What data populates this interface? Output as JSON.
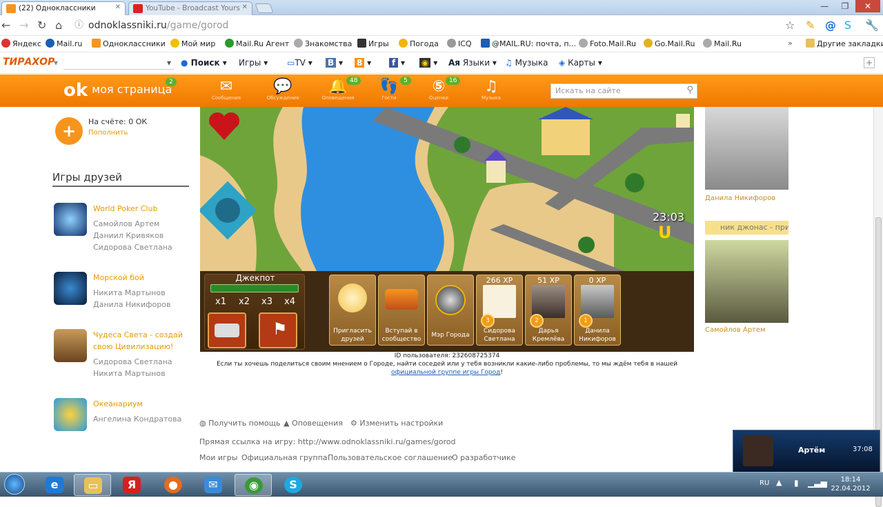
{
  "tabs": [
    {
      "title": "(22) Одноклассники"
    },
    {
      "title": "YouTube - Broadcast Yours"
    }
  ],
  "url": {
    "host": "odnoklassniki.ru",
    "path": "/game/gorod"
  },
  "bookmarks": [
    "Яндекс",
    "Mail.ru",
    "Одноклассники",
    "Мой мир",
    "Mail.Ru Агент",
    "Знакомства",
    "Игры",
    "Погода",
    "ICQ",
    "@MAIL.RU: почта, п...",
    "Foto.Mail.Ru",
    "Go.Mail.Ru",
    "Mail.Ru"
  ],
  "other_bookmarks": "Другие закладки",
  "toolbar2": {
    "brand": "ТИРАХОР",
    "search": "Поиск",
    "games": "Игры",
    "tv": "TV",
    "langs": "Языки",
    "music": "Музыка",
    "maps": "Карты"
  },
  "ok": {
    "my_page": "моя страница",
    "my_page_badge": "2",
    "search_placeholder": "Искать на сайте",
    "items": [
      {
        "cap": "Сообщения",
        "badge": ""
      },
      {
        "cap": "Обсуждения",
        "badge": ""
      },
      {
        "cap": "Оповещения",
        "badge": "48"
      },
      {
        "cap": "Гости",
        "badge": "5"
      },
      {
        "cap": "Оценки",
        "badge": "16"
      },
      {
        "cap": "Музыка",
        "badge": ""
      }
    ]
  },
  "left": {
    "balance_label": "На счёте:",
    "balance_value": "0 ОК",
    "topup": "Пополнить",
    "games_header": "Игры друзей",
    "games": [
      {
        "title": "World Poker Club",
        "friends": [
          "Самойлов Артем",
          "Даниил Кривяков",
          "Сидорова Светлана"
        ]
      },
      {
        "title": "Морской бой",
        "friends": [
          "Никита Мартынов",
          "Данила Никифоров"
        ]
      },
      {
        "title": "Чудеса Света - создай свою Цивилизацию!",
        "friends": [
          "Сидорова Светлана",
          "Никита Мартынов"
        ]
      },
      {
        "title": "Океанариум",
        "friends": [
          "Ангелина Кондратова"
        ]
      }
    ]
  },
  "game": {
    "timer": "23:03",
    "jackpot": "Джекпот",
    "multipliers": [
      "x1",
      "x2",
      "x3",
      "x4"
    ],
    "cards": [
      {
        "caption": "Пригласить друзей",
        "xp": "",
        "num": ""
      },
      {
        "caption": "Вступай в сообщество",
        "xp": "",
        "num": ""
      },
      {
        "caption": "Мэр Города",
        "xp": "",
        "num": ""
      },
      {
        "caption": "Сидорова Светлана",
        "xp": "266 XP",
        "num": "3"
      },
      {
        "caption": "Дарья Кремлёва",
        "xp": "51 XP",
        "num": "2"
      },
      {
        "caption": "Данила Никифоров",
        "xp": "0 XP",
        "num": "1"
      }
    ],
    "user_id": "ID пользователя: 232608725374",
    "msg_prefix": "Если ты хочешь поделиться своим мнением о Городе, найти соседей или у тебя возникли какие-либо проблемы, то мы ждём тебя в нашей",
    "msg_link": "официальной группе игры Город",
    "msg_suffix": "!"
  },
  "footer": {
    "help": "Получить помощь",
    "notify": "Оповещения",
    "settings": "Изменить настройки",
    "direct_link": "Прямая ссылка на игру: http://www.odnoklassniki.ru/games/gorod",
    "links": [
      "Мои игры",
      "Официальная группа",
      "Пользовательское соглашение",
      "О разработчике"
    ]
  },
  "right": {
    "names": [
      "Данила Никифоров",
      "Самойлов Артем"
    ],
    "bar_text": "ник джонас - прив"
  },
  "notification": {
    "name": "Артём",
    "time": "37:08"
  },
  "tray": {
    "lang": "RU",
    "time": "18:14",
    "date": "22.04.2012"
  }
}
